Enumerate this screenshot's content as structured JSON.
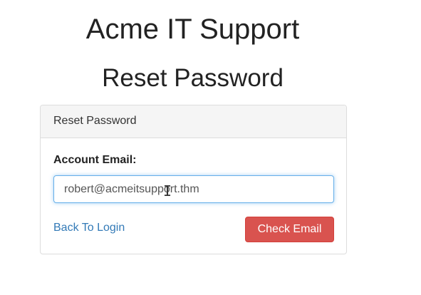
{
  "header": {
    "site_title": "Acme IT Support",
    "page_heading": "Reset Password"
  },
  "panel": {
    "heading": "Reset Password",
    "email_label": "Account Email:",
    "email_value": "robert@acmeitsupport.thm",
    "back_link": "Back To Login",
    "submit_label": "Check Email"
  },
  "colors": {
    "link": "#337ab7",
    "danger_button": "#d9534f",
    "input_focus_border": "#66afe9"
  },
  "cursor": {
    "icon": "text-cursor-icon",
    "glyph": "I"
  }
}
